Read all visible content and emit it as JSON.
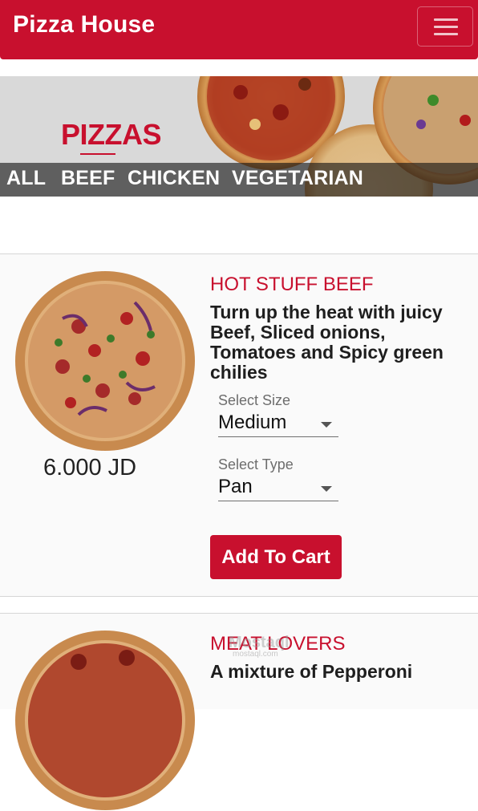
{
  "app": {
    "title": "Pizza House",
    "menu_icon": "hamburger-icon"
  },
  "banner": {
    "title": "PIZZAS"
  },
  "categories": [
    "ALL",
    "BEEF",
    "CHICKEN",
    "VEGETARIAN"
  ],
  "products": [
    {
      "name": "HOT STUFF BEEF",
      "description": "Turn up the heat with juicy Beef, Sliced onions, Tomatoes and Spicy green chilies",
      "price": "6.000 JD",
      "size_label": "Select Size",
      "size_value": "Medium",
      "type_label": "Select Type",
      "type_value": "Pan",
      "button": "Add To Cart"
    },
    {
      "name": "MEAT LOVERS",
      "description": "A mixture of Pepperoni"
    }
  ],
  "watermark": {
    "main": "Mostaql",
    "sub": "mostaql.com"
  },
  "colors": {
    "brand": "#c8102e",
    "background": "#fafafa",
    "text": "#1e1e1e"
  }
}
